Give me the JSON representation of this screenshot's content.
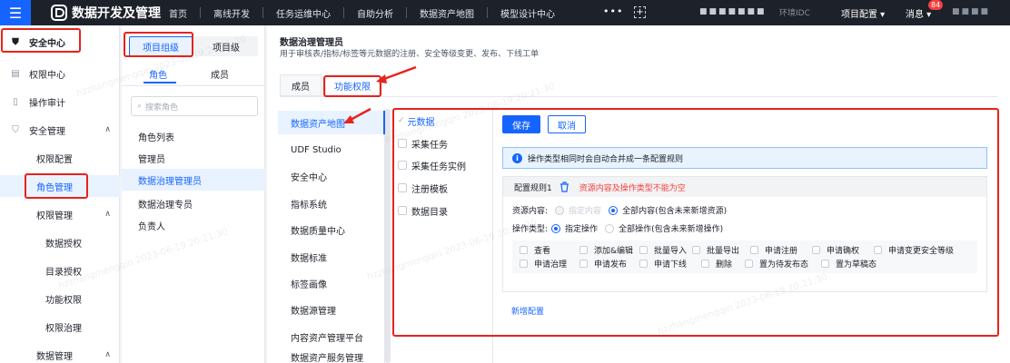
{
  "topbar": {
    "menu_icon": "hamburger-icon",
    "brand": "数据开发及管理",
    "nav": [
      "首页",
      "离线开发",
      "任务运维中心",
      "自助分析",
      "数据资产地图",
      "模型设计中心"
    ],
    "more": "•••",
    "masked_text": "■■■■■■■",
    "obscured": "环境IDC",
    "project_config": "项目配置 ▾",
    "messages": "消息 ▾",
    "message_badge": "84",
    "user_masked": "■■■■"
  },
  "sidebar": {
    "items": [
      {
        "label": "安全中心",
        "icon": "shield-icon"
      },
      {
        "label": "权限中心",
        "icon": "document-icon"
      },
      {
        "label": "操作审计",
        "icon": "file-icon"
      },
      {
        "label": "安全管理",
        "icon": "shield-icon"
      },
      {
        "label": "权限配置"
      },
      {
        "label": "角色管理"
      },
      {
        "label": "权限管理"
      },
      {
        "label": "数据授权"
      },
      {
        "label": "目录授权"
      },
      {
        "label": "功能权限"
      },
      {
        "label": "权限治理"
      },
      {
        "label": "数据管理"
      }
    ]
  },
  "role_panel": {
    "group_tabs": [
      "项目组级",
      "项目级"
    ],
    "sub_tabs": [
      "角色",
      "成员"
    ],
    "search_placeholder": "搜索角色",
    "roles": [
      "角色列表",
      "管理员",
      "数据治理管理员",
      "数据治理专员",
      "负责人"
    ]
  },
  "main": {
    "title": "数据治理管理员",
    "description": "用于审核表/指标/标签等元数据的注册、安全等级变更、发布、下线工单",
    "tabs": [
      "成员",
      "功能权限"
    ],
    "modules": [
      "数据资产地图",
      "UDF Studio",
      "安全中心",
      "指标系统",
      "数据质量中心",
      "数据标准",
      "标签画像",
      "数据源管理",
      "内容资产管理平台",
      "数据资产服务管理"
    ],
    "features": [
      "元数据",
      "采集任务",
      "采集任务实例",
      "注册模板",
      "数据目录"
    ],
    "config": {
      "save": "保存",
      "cancel": "取消",
      "info": "操作类型相同时会自动合并成一条配置规则",
      "rule_title": "配置规则1",
      "rule_error": "资源内容及操作类型不能为空",
      "resource_label": "资源内容:",
      "resource_opt1": "指定内容",
      "resource_opt2": "全部内容(包含未来新增资源)",
      "op_type_label": "操作类型:",
      "op_opt1": "指定操作",
      "op_opt2": "全部操作(包含未来新增操作)",
      "ops": [
        "查看",
        "添加&编辑",
        "批量导入",
        "批量导出",
        "申请注册",
        "申请确权",
        "申请变更安全等级",
        "申请治理",
        "申请发布",
        "申请下线",
        "删除",
        "置为待发布态",
        "置为草稿态"
      ],
      "add_config": "新增配置"
    }
  },
  "watermark": "hzzhangmengqin 2023-06-19 20:21:30",
  "colors": {
    "primary": "#1664ff",
    "highlight": "#e8221c",
    "topbar": "#1d2129"
  }
}
